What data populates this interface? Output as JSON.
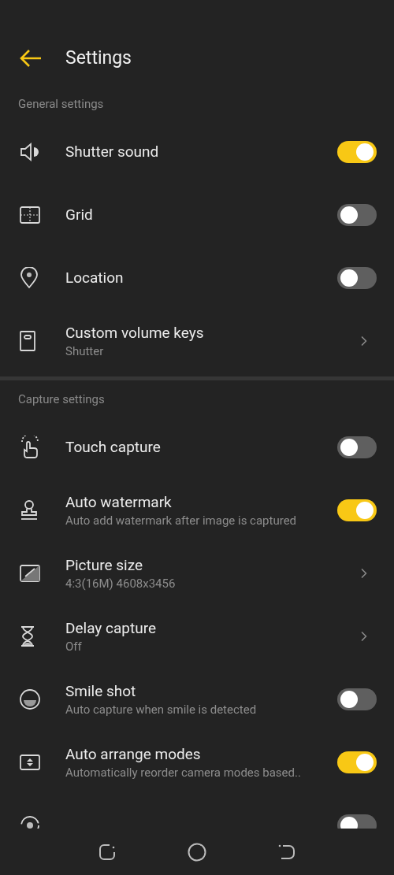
{
  "header": {
    "title": "Settings"
  },
  "sections": [
    {
      "title": "General settings",
      "items": [
        {
          "kind": "toggle",
          "title": "Shutter sound",
          "on": true
        },
        {
          "kind": "toggle",
          "title": "Grid",
          "on": false
        },
        {
          "kind": "toggle",
          "title": "Location",
          "on": false
        },
        {
          "kind": "link",
          "title": "Custom volume keys",
          "subtitle": "Shutter"
        }
      ]
    },
    {
      "title": "Capture settings",
      "items": [
        {
          "kind": "toggle",
          "title": "Touch capture",
          "on": false
        },
        {
          "kind": "toggle",
          "title": "Auto watermark",
          "subtitle": "Auto add watermark after image is captured",
          "on": true
        },
        {
          "kind": "link",
          "title": "Picture size",
          "subtitle": "4:3(16M) 4608x3456"
        },
        {
          "kind": "link",
          "title": "Delay capture",
          "subtitle": "Off"
        },
        {
          "kind": "toggle",
          "title": "Smile shot",
          "subtitle": "Auto capture when smile is detected",
          "on": false
        },
        {
          "kind": "toggle",
          "title": "Auto arrange modes",
          "subtitle": "Automatically reorder camera modes based..",
          "on": true
        },
        {
          "kind": "toggle",
          "on": false
        }
      ]
    }
  ]
}
